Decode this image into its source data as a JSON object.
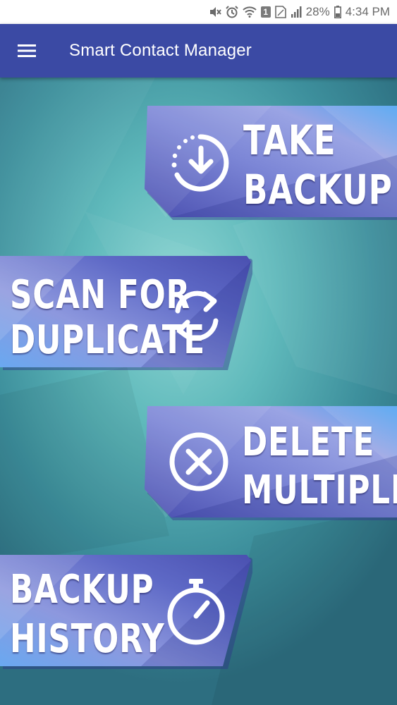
{
  "status_bar": {
    "battery": "28%",
    "time": "4:34 PM",
    "sim_slot": "1",
    "icons": [
      "mute-icon",
      "alarm-icon",
      "wifi-icon",
      "sim-icon",
      "signal-icon",
      "battery-icon"
    ]
  },
  "app_bar": {
    "title": "Smart Contact Manager",
    "menu_icon": "hamburger-menu-icon",
    "color": "#3b4aa4"
  },
  "tiles": [
    {
      "id": "take-backup",
      "line1": "TAKE",
      "line2": "BACKUP",
      "icon": "download-clock-icon"
    },
    {
      "id": "scan-duplicate",
      "line1": "SCAN FOR",
      "line2": "DUPLICATE",
      "icon": "refresh-icon"
    },
    {
      "id": "delete-multiple",
      "line1": "DELETE",
      "line2": "MULTIPLE",
      "icon": "cancel-circle-icon"
    },
    {
      "id": "backup-history",
      "line1": "BACKUP",
      "line2": "HISTORY",
      "icon": "stopwatch-icon"
    }
  ],
  "colors": {
    "tile_blue_light": "#6aa8f0",
    "tile_violet": "#5f6ac7",
    "tile_dark": "#3b43a0",
    "background": "#5fb9bb"
  }
}
